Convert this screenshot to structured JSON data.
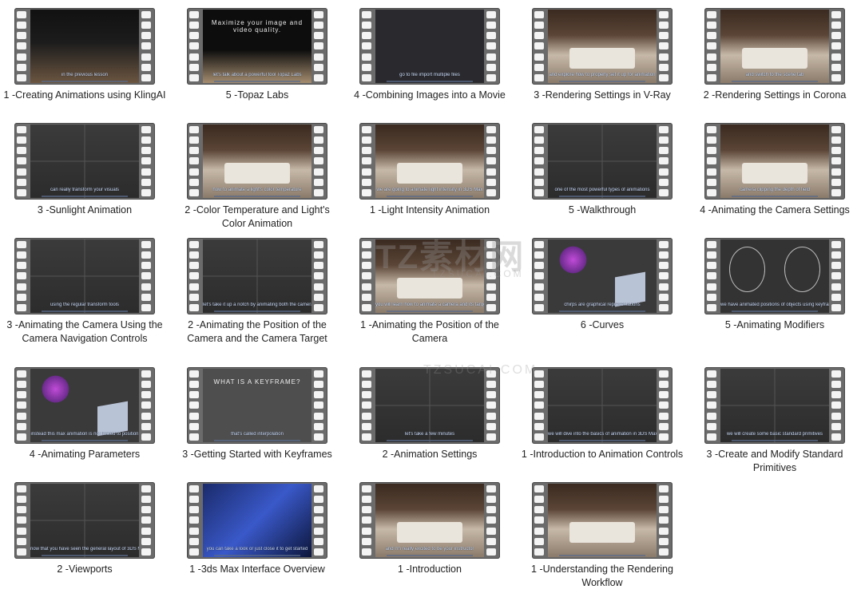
{
  "watermark": {
    "main": "TZ素材网",
    "sub": "TZSUCAI.COM",
    "sub2": "TZSUCAI.COM"
  },
  "items": [
    {
      "title": "1 -Creating Animations using KlingAI",
      "subtitle": "in the previous lesson",
      "scene": "web"
    },
    {
      "title": "5 -Topaz Labs",
      "subtitle": "let's talk about a powerful tool Topaz Labs",
      "scene": "topaz",
      "heading": "Maximize your image and video quality."
    },
    {
      "title": "4 -Combining Images into a Movie",
      "subtitle": "go to file import multiple files",
      "scene": "dark"
    },
    {
      "title": "3 -Rendering Settings in V-Ray",
      "subtitle": "and explore how to properly set it up for animation",
      "scene": "room"
    },
    {
      "title": "2 -Rendering Settings in Corona",
      "subtitle": "and switch to the scene tab",
      "scene": "room"
    },
    {
      "title": "3 -Sunlight Animation",
      "subtitle": "can really transform your visuals",
      "scene": "viewport"
    },
    {
      "title": "2 -Color Temperature and Light's Color Animation",
      "subtitle": "how to animate a light's color temperature",
      "scene": "room"
    },
    {
      "title": "1 -Light Intensity Animation",
      "subtitle": "we are going to animate light intensity in 3DS Max",
      "scene": "room"
    },
    {
      "title": "5 -Walkthrough",
      "subtitle": "one of the most powerful types of animations",
      "scene": "viewport"
    },
    {
      "title": "4 -Animating the Camera Settings",
      "subtitle": "camera clipping the depth of field",
      "scene": "room"
    },
    {
      "title": "3 -Animating the Camera Using the Camera Navigation Controls",
      "subtitle": "using the regular transform tools",
      "scene": "viewport"
    },
    {
      "title": "2 -Animating the Position of the Camera and the Camera Target",
      "subtitle": "let's take it up a notch by animating both the camera",
      "scene": "viewport"
    },
    {
      "title": "1 -Animating the Position of the Camera",
      "subtitle": "you will learn how to animate a camera and its target",
      "scene": "room"
    },
    {
      "title": "6 -Curves",
      "subtitle": "chirps are graphical representations",
      "scene": "curves"
    },
    {
      "title": "5 -Animating Modifiers",
      "subtitle": "we have animated positions of objects using keyframe",
      "scene": "mod"
    },
    {
      "title": "4 -Animating Parameters",
      "subtitle": "instead this max animation is not limited to position",
      "scene": "curves"
    },
    {
      "title": "3 -Getting Started with Keyframes",
      "subtitle": "that's called interpolation",
      "scene": "text",
      "heading": "WHAT IS A KEYFRAME?"
    },
    {
      "title": "2 -Animation Settings",
      "subtitle": "let's take a few minutes",
      "scene": "viewport"
    },
    {
      "title": "1 -Introduction to Animation Controls",
      "subtitle": "we will dive into the basics of animation in 3DS Max",
      "scene": "viewport"
    },
    {
      "title": "3 -Create and Modify Standard Primitives",
      "subtitle": "we will create some basic standard primitives",
      "scene": "viewport"
    },
    {
      "title": "2 -Viewports",
      "subtitle": "now that you have seen the general layout of 3DS Max",
      "scene": "viewport"
    },
    {
      "title": "1 -3ds Max Interface Overview",
      "subtitle": "you can take a look or just close it to get started",
      "scene": "blue"
    },
    {
      "title": "1 -Introduction",
      "subtitle": "and I'm really excited to be your instructor",
      "scene": "room"
    },
    {
      "title": "1 -Understanding the Rendering Workflow",
      "subtitle": "",
      "scene": "room"
    }
  ]
}
